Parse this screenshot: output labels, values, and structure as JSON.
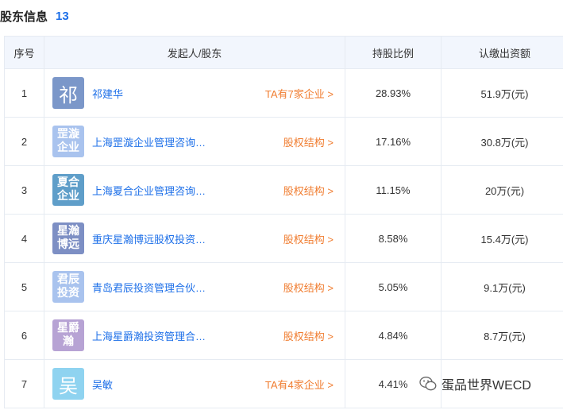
{
  "header": {
    "title": "股东信息",
    "count": "13"
  },
  "table": {
    "columns": [
      "序号",
      "发起人/股东",
      "持股比例",
      "认缴出资额"
    ],
    "rows": [
      {
        "index": "1",
        "logo_text": "祁",
        "logo_color": "#7b97c9",
        "logo_style": "big",
        "name": "祁建华",
        "link": "TA有7家企业 >",
        "ratio": "28.93%",
        "amount": "51.9万(元)"
      },
      {
        "index": "2",
        "logo_text": "罡漩\n企业",
        "logo_color": "#a9c3ee",
        "logo_style": "small",
        "name": "上海罡漩企业管理咨询合伙企业",
        "link": "股权结构 >",
        "ratio": "17.16%",
        "amount": "30.8万(元)"
      },
      {
        "index": "3",
        "logo_text": "夏合\n企业",
        "logo_color": "#5f9ec9",
        "logo_style": "small",
        "name": "上海夏合企业管理咨询合伙企业",
        "link": "股权结构 >",
        "ratio": "11.15%",
        "amount": "20万(元)"
      },
      {
        "index": "4",
        "logo_text": "星瀚\n博远",
        "logo_color": "#7d8fc4",
        "logo_style": "small",
        "name": "重庆星瀚博远股权投资合伙企业",
        "link": "股权结构 >",
        "ratio": "8.58%",
        "amount": "15.4万(元)"
      },
      {
        "index": "5",
        "logo_text": "君辰\n投资",
        "logo_color": "#a9c3ee",
        "logo_style": "small",
        "name": "青岛君辰投资管理合伙企业",
        "link": "股权结构 >",
        "ratio": "5.05%",
        "amount": "9.1万(元)"
      },
      {
        "index": "6",
        "logo_text": "星爵\n瀚",
        "logo_color": "#b7a3d4",
        "logo_style": "small",
        "name": "上海星爵瀚投资管理合伙企业",
        "link": "股权结构 >",
        "ratio": "4.84%",
        "amount": "8.7万(元)"
      },
      {
        "index": "7",
        "logo_text": "吴",
        "logo_color": "#8fd3f0",
        "logo_style": "big",
        "name": "吴敏",
        "link": "TA有4家企业 >",
        "ratio": "4.41%",
        "amount": ""
      }
    ]
  },
  "watermark": {
    "text": "蛋品世界WECD"
  }
}
